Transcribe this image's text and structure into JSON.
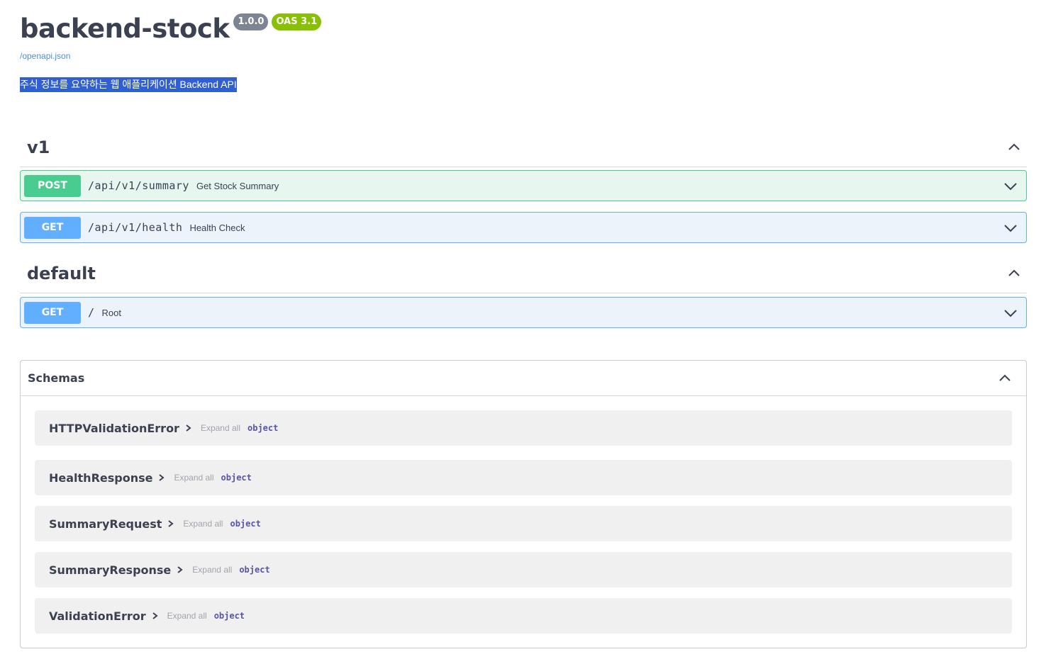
{
  "info": {
    "title": "backend-stock",
    "version_badge": "1.0.0",
    "oas_badge": "OAS 3.1",
    "spec_link": "/openapi.json",
    "description": "주식 정보를 요약하는 웹 애플리케이션 Backend API"
  },
  "tags": [
    {
      "name": "v1",
      "operations": [
        {
          "method": "POST",
          "path": "/api/v1/summary",
          "summary": "Get Stock Summary"
        },
        {
          "method": "GET",
          "path": "/api/v1/health",
          "summary": "Health Check"
        }
      ]
    },
    {
      "name": "default",
      "operations": [
        {
          "method": "GET",
          "path": "/",
          "summary": "Root"
        }
      ]
    }
  ],
  "schemas": {
    "title": "Schemas",
    "models": [
      {
        "name": "HTTPValidationError",
        "expand": "Expand all",
        "type": "object"
      },
      {
        "name": "HealthResponse",
        "expand": "Expand all",
        "type": "object"
      },
      {
        "name": "SummaryRequest",
        "expand": "Expand all",
        "type": "object"
      },
      {
        "name": "SummaryResponse",
        "expand": "Expand all",
        "type": "object"
      },
      {
        "name": "ValidationError",
        "expand": "Expand all",
        "type": "object"
      }
    ]
  },
  "colors": {
    "post": "#49cc90",
    "get": "#61affe",
    "oas": "#89bf04",
    "version": "#7d8492"
  }
}
